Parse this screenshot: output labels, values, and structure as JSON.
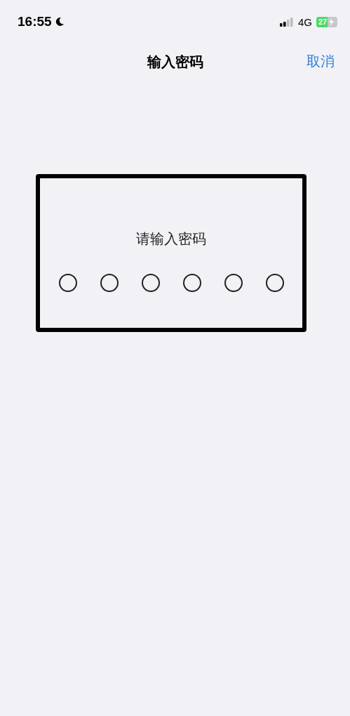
{
  "status_bar": {
    "time": "16:55",
    "network": "4G",
    "battery": "27"
  },
  "nav": {
    "title": "输入密码",
    "cancel": "取消"
  },
  "dialog": {
    "prompt": "请输入密码",
    "digits": [
      {
        "filled": false
      },
      {
        "filled": false
      },
      {
        "filled": false
      },
      {
        "filled": false
      },
      {
        "filled": false
      },
      {
        "filled": false
      }
    ]
  }
}
